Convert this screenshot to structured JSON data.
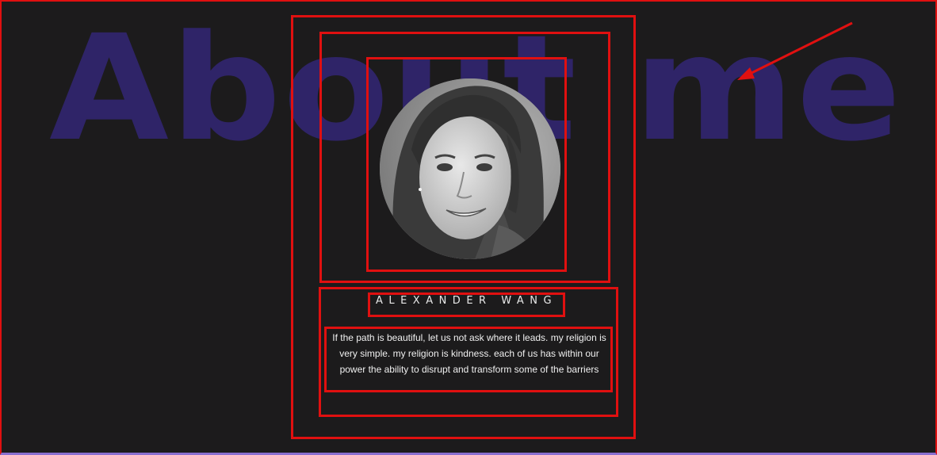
{
  "section": {
    "heading": "About me"
  },
  "profile": {
    "name": "Alexander Wang",
    "bio": "If the path is beautiful, let us not ask where it leads. my religion is very simple. my religion is kindness. each of us has within our power the ability to disrupt and transform some of the barriers"
  },
  "colors": {
    "background": "#1c1b1c",
    "heading": "#2f2468",
    "annotation": "#e01010",
    "text": "#f0f0f0",
    "bottom_border": "#8a6fd0"
  },
  "icons": {
    "annotation_arrow": "arrow-icon"
  }
}
